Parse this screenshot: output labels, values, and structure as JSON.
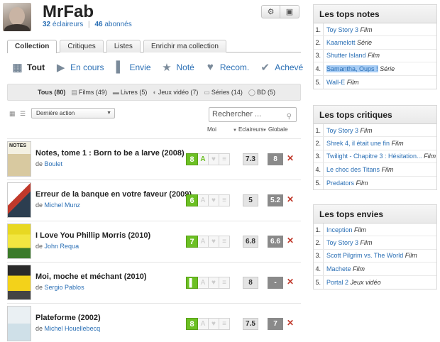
{
  "profile": {
    "username": "MrFab",
    "eclaireurs_count": "32",
    "eclaireurs_label": "éclaireurs",
    "abonnes_count": "46",
    "abonnes_label": "abonnés"
  },
  "header_buttons": {
    "settings_icon": "gear-icon",
    "profile_icon": "user-card-icon"
  },
  "tabs": [
    "Collection",
    "Critiques",
    "Listes",
    "Enrichir ma collection"
  ],
  "filters": [
    {
      "label": "Tout",
      "icon": "stack-icon"
    },
    {
      "label": "En cours",
      "icon": "play-icon"
    },
    {
      "label": "Envie",
      "icon": "bookmark-icon"
    },
    {
      "label": "Noté",
      "icon": "star-icon"
    },
    {
      "label": "Recom.",
      "icon": "heart-icon"
    },
    {
      "label": "Achevé",
      "icon": "check-icon"
    }
  ],
  "categories": [
    {
      "label": "Tous (80)"
    },
    {
      "label": "Films (49)"
    },
    {
      "label": "Livres (5)"
    },
    {
      "label": "Jeux vidéo (7)"
    },
    {
      "label": "Séries (14)"
    },
    {
      "label": "BD (5)"
    }
  ],
  "sort": {
    "selected": "Dernière action"
  },
  "search": {
    "placeholder": "Rechercher ..."
  },
  "columns": {
    "moi": "Moi",
    "eclaireurs": "Eclaireurs",
    "globale": "Globale"
  },
  "items": [
    {
      "title": "Notes, tome 1 : Born to be a larve (2008)",
      "by": "de",
      "author": "Boulet",
      "my": "8",
      "eclaireurs": "7.3",
      "globale": "8",
      "poster_text": "NOTES"
    },
    {
      "title": "Erreur de la banque en votre faveur (2009)",
      "by": "de",
      "author": "Michel Munz",
      "my": "6",
      "eclaireurs": "5",
      "globale": "5.2",
      "poster_text": ""
    },
    {
      "title": "I Love You Phillip Morris (2010)",
      "by": "de",
      "author": "John Requa",
      "my": "7",
      "eclaireurs": "6.8",
      "globale": "6.6",
      "poster_text": ""
    },
    {
      "title": "Moi, moche et méchant (2010)",
      "by": "de",
      "author": "Sergio Pablos",
      "my": "",
      "eclaireurs": "8",
      "globale": "-",
      "poster_text": ""
    },
    {
      "title": "Plateforme (2002)",
      "by": "de",
      "author": "Michel Houellebecq",
      "my": "8",
      "eclaireurs": "7.5",
      "globale": "7",
      "poster_text": ""
    }
  ],
  "tops_notes": {
    "title": "Les tops notes",
    "items": [
      {
        "n": "1.",
        "name": "Toy Story 3",
        "type": "Film"
      },
      {
        "n": "2.",
        "name": "Kaamelott",
        "type": "Série"
      },
      {
        "n": "3.",
        "name": "Shutter Island",
        "type": "Film"
      },
      {
        "n": "4.",
        "name": "Samantha, Oups !",
        "type": "Série"
      },
      {
        "n": "5.",
        "name": "Wall-E",
        "type": "Film"
      }
    ]
  },
  "tops_critiques": {
    "title": "Les tops critiques",
    "items": [
      {
        "n": "1.",
        "name": "Toy Story 3",
        "type": "Film"
      },
      {
        "n": "2.",
        "name": "Shrek 4, il était une fin",
        "type": "Film"
      },
      {
        "n": "3.",
        "name": "Twilight - Chapitre 3 : Hésitation...",
        "type": "Film"
      },
      {
        "n": "4.",
        "name": "Le choc des Titans",
        "type": "Film"
      },
      {
        "n": "5.",
        "name": "Predators",
        "type": "Film"
      }
    ]
  },
  "tops_envies": {
    "title": "Les tops envies",
    "items": [
      {
        "n": "1.",
        "name": "Inception",
        "type": "Film"
      },
      {
        "n": "2.",
        "name": "Toy Story 3",
        "type": "Film"
      },
      {
        "n": "3.",
        "name": "Scott Pilgrim vs. The World",
        "type": "Film"
      },
      {
        "n": "4.",
        "name": "Machete",
        "type": "Film"
      },
      {
        "n": "5.",
        "name": "Portal 2",
        "type": "Jeux vidéo"
      }
    ]
  },
  "colors": {
    "accent_blue": "#2a6fb5",
    "note_green": "#6cc024",
    "delete_red": "#c0392b",
    "highlight": "#a8cdf5"
  }
}
